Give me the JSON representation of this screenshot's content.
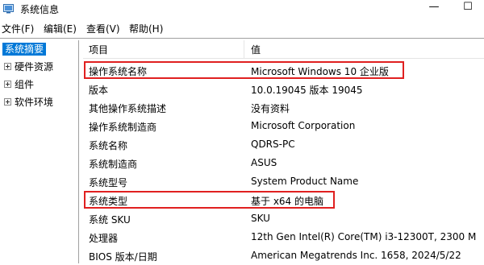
{
  "window": {
    "title": "系统信息",
    "minimize_glyph": "—",
    "maximize_glyph": "☐"
  },
  "menu": [
    "文件(F)",
    "编辑(E)",
    "查看(V)",
    "帮助(H)"
  ],
  "tree": {
    "root": "系统摘要",
    "children": [
      "硬件资源",
      "组件",
      "软件环境"
    ]
  },
  "table": {
    "headers": [
      "项目",
      "值"
    ],
    "rows": [
      {
        "name": "操作系统名称",
        "value": "Microsoft Windows 10 企业版",
        "highlighted": true
      },
      {
        "name": "版本",
        "value": "10.0.19045 版本 19045"
      },
      {
        "name": "其他操作系统描述",
        "value": "没有资料"
      },
      {
        "name": "操作系统制造商",
        "value": "Microsoft Corporation"
      },
      {
        "name": "系统名称",
        "value": "QDRS-PC"
      },
      {
        "name": "系统制造商",
        "value": "ASUS"
      },
      {
        "name": "系统型号",
        "value": "System Product Name"
      },
      {
        "name": "系统类型",
        "value": "基于 x64 的电脑",
        "highlighted": true
      },
      {
        "name": "系统 SKU",
        "value": "SKU"
      },
      {
        "name": "处理器",
        "value": "12th Gen Intel(R) Core(TM) i3-12300T,   2300 M"
      },
      {
        "name": "BIOS 版本/日期",
        "value": "American Megatrends Inc. 1658, 2024/5/22"
      }
    ]
  },
  "colors": {
    "selection": "#0078d7",
    "highlight_box": "#e02020"
  },
  "icons": {
    "app": "system-info-icon",
    "expand": "plus-box-icon"
  }
}
